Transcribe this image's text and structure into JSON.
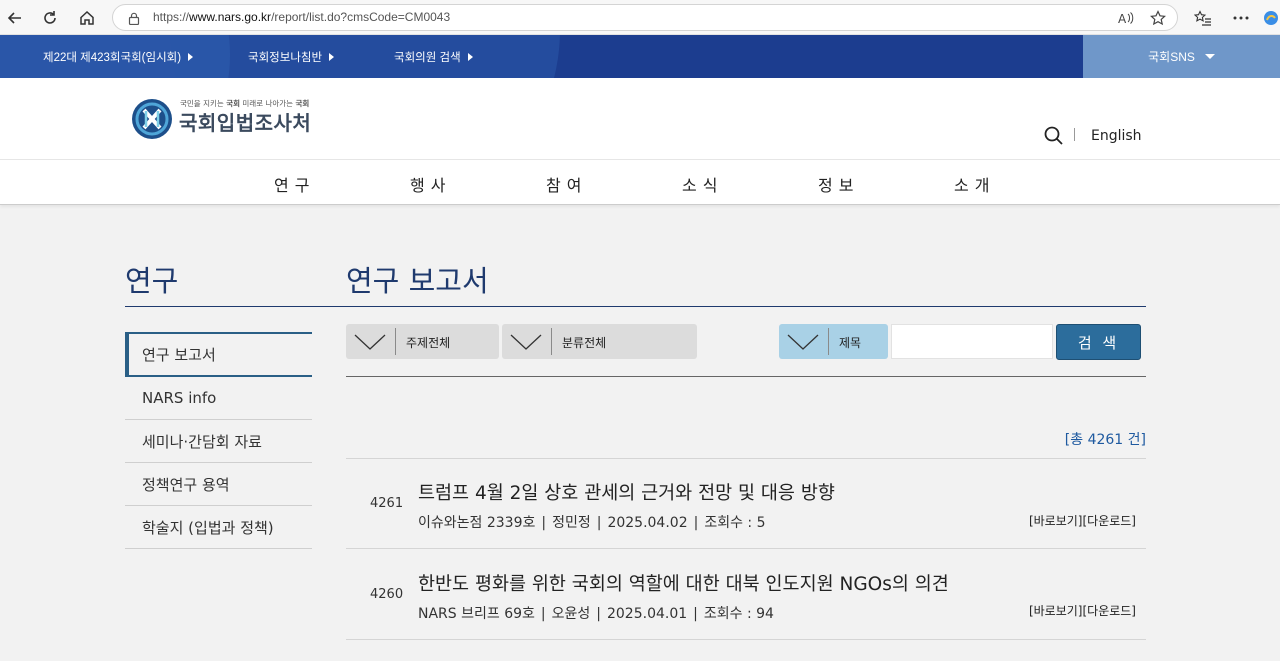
{
  "browser": {
    "url_prefix": "https://",
    "url_host": "www.nars.go.kr",
    "url_path": "/report/list.do?cmsCode=CM0043"
  },
  "topbar": {
    "items": [
      "제22대 제423회국회(임시회)",
      "국회정보나침반",
      "국회의원 검색"
    ],
    "sns_label": "국회SNS"
  },
  "header": {
    "logo_tagline_a": "국민을 지키는",
    "logo_tagline_a_strong": "국회",
    "logo_tagline_b": "미래로 나아가는",
    "logo_tagline_b_strong": "국회",
    "logo_text": "국회입법조사처",
    "english_label": "English"
  },
  "gnb": [
    "연구",
    "행사",
    "참여",
    "소식",
    "정보",
    "소개"
  ],
  "sidebar": {
    "title": "연구",
    "items": [
      "연구 보고서",
      "NARS info",
      "세미나·간담회 자료",
      "정책연구 용역",
      "학술지 (입법과 정책)"
    ]
  },
  "main": {
    "title": "연구 보고서",
    "filters": {
      "topic": "주제전체",
      "category": "분류전체",
      "field": "제목",
      "search_button": "검 색"
    },
    "total": "[총 4261 건]",
    "rows": [
      {
        "num": "4261",
        "title": "트럼프 4월 2일 상호 관세의 근거와 전망 및 대응 방향",
        "series": "이슈와논점 2339호",
        "author": "정민정",
        "date": "2025.04.02",
        "views": "조회수 : 5",
        "view_label": "[바로보기]",
        "download_label": "[다운로드]"
      },
      {
        "num": "4260",
        "title": "한반도 평화를 위한 국회의 역할에 대한 대북 인도지원 NGOs의 의견",
        "series": "NARS 브리프 69호",
        "author": "오윤성",
        "date": "2025.04.01",
        "views": "조회수 : 94",
        "view_label": "[바로보기]",
        "download_label": "[다운로드]"
      }
    ]
  },
  "colors": {
    "topbar": "#1c3d8f",
    "sns": "#6f97c9",
    "navy_text": "#1f3a6e",
    "search_button": "#2c6d9c",
    "field_select": "#a9d1e6"
  }
}
